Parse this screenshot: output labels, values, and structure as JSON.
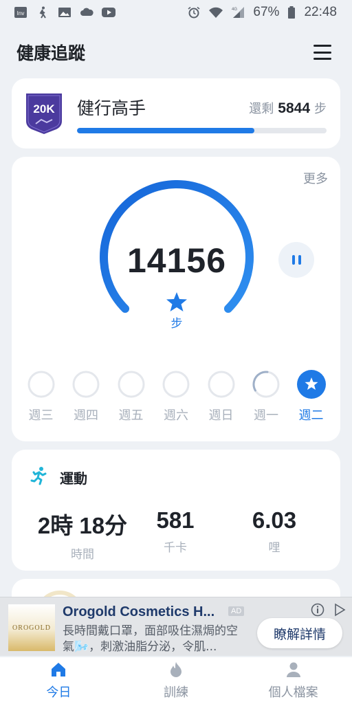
{
  "status_bar": {
    "battery": "67%",
    "time": "22:48",
    "network": "4G",
    "left_icons": [
      "inv-app-icon",
      "walking-icon",
      "image-icon",
      "cloud-icon",
      "youtube-icon"
    ],
    "right_icons": [
      "alarm-icon",
      "wifi-icon",
      "signal-icon",
      "battery-icon"
    ]
  },
  "header": {
    "title": "健康追蹤"
  },
  "challenge": {
    "badge_text": "20K",
    "title": "健行高手",
    "remaining_prefix": "還剩",
    "remaining_value": "5844",
    "remaining_unit": "步",
    "progress": 0.71
  },
  "steps": {
    "more": "更多",
    "count": "14156",
    "unit": "步",
    "ring_progress": 1.0,
    "week": [
      {
        "label": "週三",
        "progress": 0
      },
      {
        "label": "週四",
        "progress": 0
      },
      {
        "label": "週五",
        "progress": 0
      },
      {
        "label": "週六",
        "progress": 0
      },
      {
        "label": "週日",
        "progress": 0
      },
      {
        "label": "週一",
        "progress": 0.35
      },
      {
        "label": "週二",
        "progress": 1,
        "achieved": true
      }
    ]
  },
  "exercise": {
    "title": "運動",
    "stats": [
      {
        "value": "2時 18分",
        "label": "時間"
      },
      {
        "value": "581",
        "label": "千卡"
      },
      {
        "value": "6.03",
        "label": "哩"
      }
    ]
  },
  "ad": {
    "thumb_text": "OROGOLD",
    "title": "Orogold Cosmetics H...",
    "tag": "AD",
    "body": "長時間戴口罩，面部吸住濕焗的空氣🌬️，刺激油脂分泌，令肌...",
    "cta": "瞭解詳情"
  },
  "bottom_nav": [
    {
      "label": "今日",
      "icon": "home-icon",
      "active": true
    },
    {
      "label": "訓練",
      "icon": "flame-icon",
      "active": false
    },
    {
      "label": "個人檔案",
      "icon": "person-icon",
      "active": false
    }
  ],
  "colors": {
    "accent": "#1f7ae6",
    "ring_gradient_start": "#1565d8",
    "ring_gradient_end": "#2f8ff0",
    "badge": "#4b3a9e",
    "background": "#eef1f5"
  }
}
